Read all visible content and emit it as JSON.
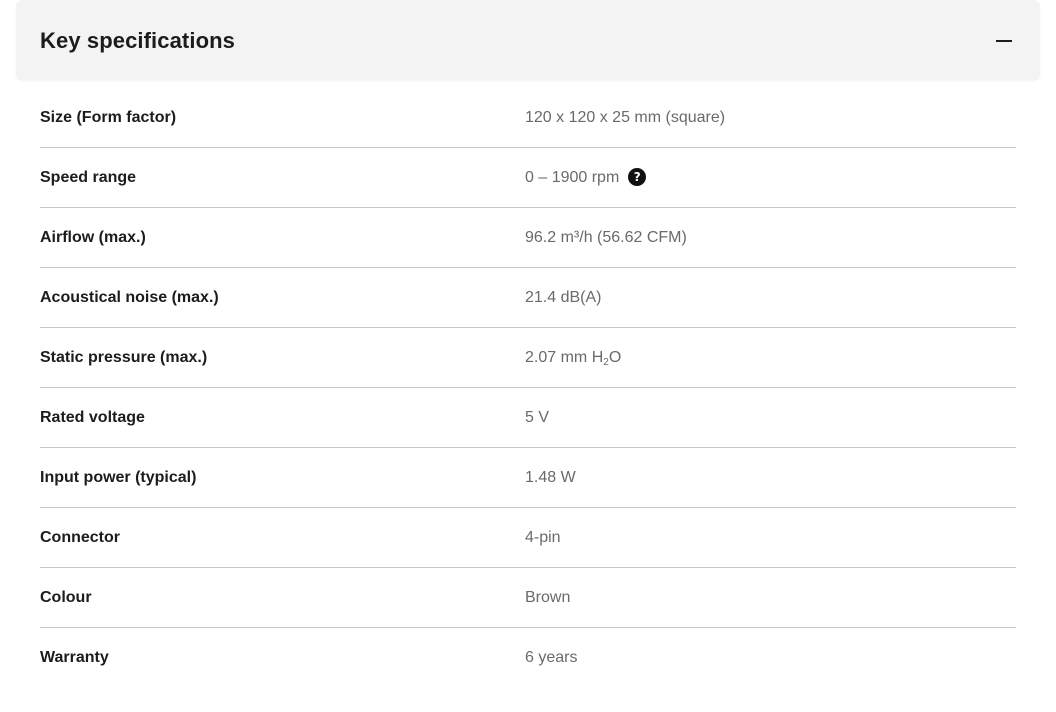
{
  "section": {
    "title": "Key specifications",
    "collapse_icon": "minus-icon"
  },
  "specs": [
    {
      "label": "Size (Form factor)",
      "value": "120 x 120 x 25 mm (square)"
    },
    {
      "label": "Speed range",
      "value": "0 – 1900 rpm",
      "help_icon": "question-circle-icon",
      "help_glyph": "?"
    },
    {
      "label": "Airflow (max.)",
      "value": "96.2 m³/h (56.62 CFM)"
    },
    {
      "label": "Acoustical noise (max.)",
      "value": "21.4 dB(A)"
    },
    {
      "label": "Static pressure (max.)",
      "value_prefix": "2.07 mm H",
      "value_sub": "2",
      "value_suffix": "O"
    },
    {
      "label": "Rated voltage",
      "value": "5 V"
    },
    {
      "label": "Input power (typical)",
      "value": "1.48 W"
    },
    {
      "label": "Connector",
      "value": "4-pin"
    },
    {
      "label": "Colour",
      "value": "Brown"
    },
    {
      "label": "Warranty",
      "value": "6 years"
    }
  ]
}
